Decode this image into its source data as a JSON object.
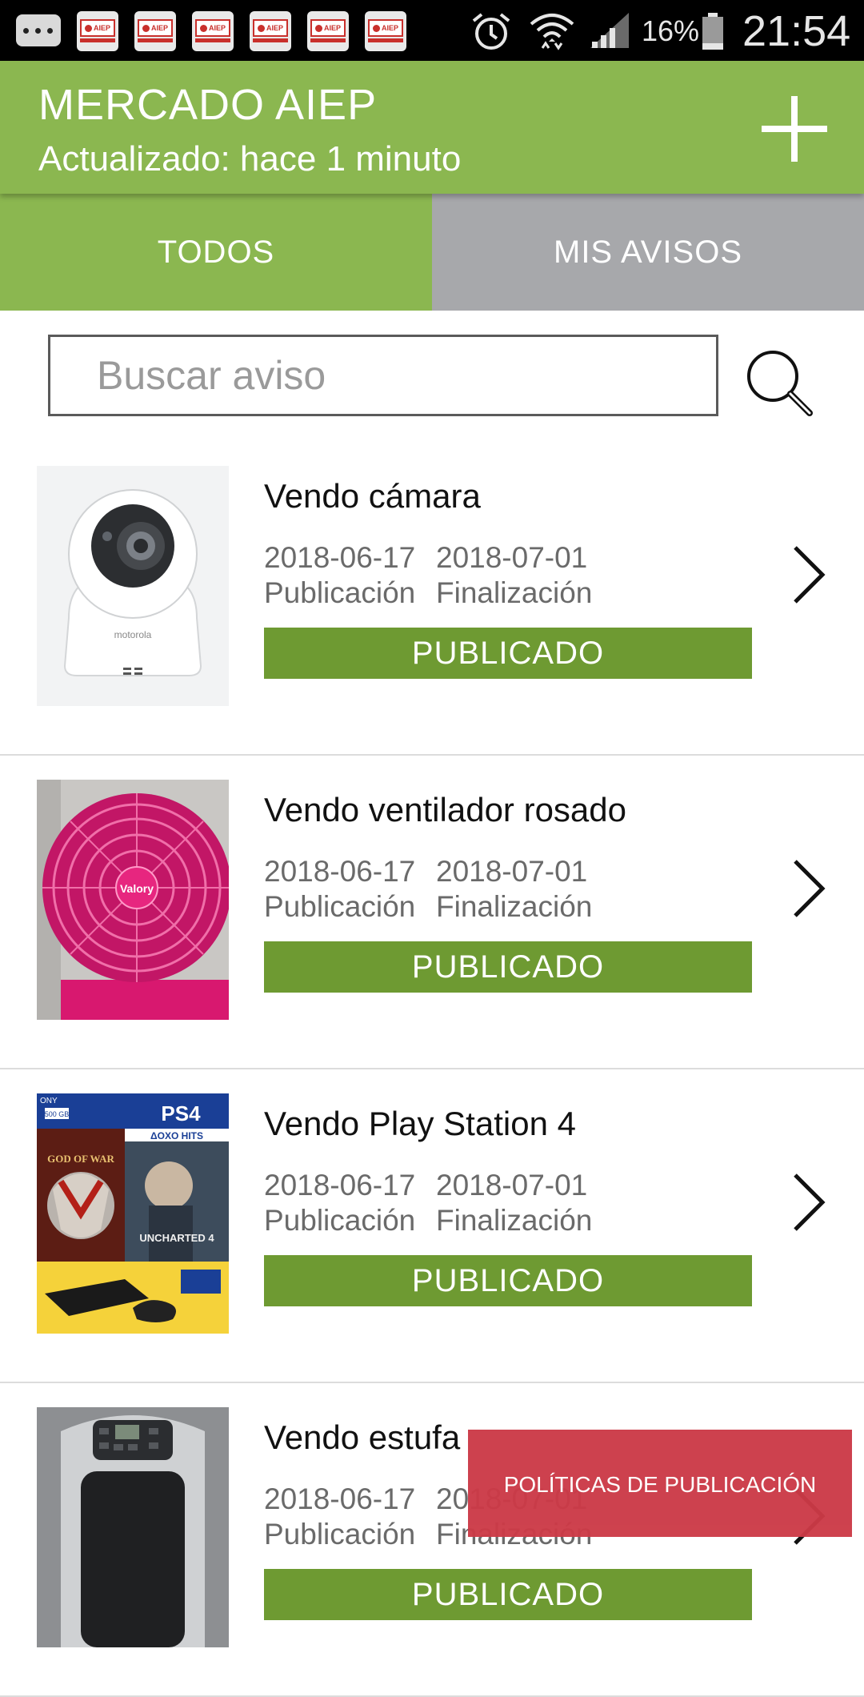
{
  "status_bar": {
    "notifications": [
      "AIEP",
      "AIEP",
      "AIEP",
      "AIEP",
      "AIEP",
      "AIEP"
    ],
    "battery": "16%",
    "time": "21:54",
    "icons": [
      "more-icon",
      "alarm-icon",
      "wifi-icon",
      "signal-icon",
      "battery-icon"
    ]
  },
  "header": {
    "title": "MERCADO AIEP",
    "subtitle": "Actualizado: hace 1 minuto",
    "add_icon": "plus-icon"
  },
  "tabs": [
    {
      "label": "TODOS",
      "active": true
    },
    {
      "label": "MIS AVISOS",
      "active": false
    }
  ],
  "search": {
    "placeholder": "Buscar aviso",
    "value": "",
    "icon": "search-icon"
  },
  "listings": [
    {
      "title": "Vendo cámara",
      "pub_date": "2018-06-17",
      "pub_label": "Publicación",
      "end_date": "2018-07-01",
      "end_label": "Finalización",
      "status": "PUBLICADO"
    },
    {
      "title": "Vendo ventilador rosado",
      "pub_date": "2018-06-17",
      "pub_label": "Publicación",
      "end_date": "2018-07-01",
      "end_label": "Finalización",
      "status": "PUBLICADO"
    },
    {
      "title": "Vendo Play Station 4",
      "pub_date": "2018-06-17",
      "pub_label": "Publicación",
      "end_date": "2018-07-01",
      "end_label": "Finalización",
      "status": "PUBLICADO"
    },
    {
      "title": "Vendo estufa",
      "pub_date": "2018-06-17",
      "pub_label": "Publicación",
      "end_date": "2018-07-01",
      "end_label": "Finalización",
      "status": "PUBLICADO"
    }
  ],
  "thumb_texts": {
    "camera_brand": "motorola",
    "fan_brand": "Valory",
    "ps4_brand": "PS4",
    "ps4_hits": "ΔOXO HITS",
    "ps4_game1": "GOD OF WAR",
    "ps4_game2": "UNCHARTED 4",
    "ps4_storage": "500 GB",
    "ps4_sony": "ONY"
  },
  "footer": {
    "policies_label": "POLÍTICAS DE PUBLICACIÓN"
  },
  "colors": {
    "brand_green": "#8bb750",
    "status_green": "#6e9a32",
    "tab_inactive": "#a7a8ab",
    "policies_red": "#cc3a47"
  }
}
